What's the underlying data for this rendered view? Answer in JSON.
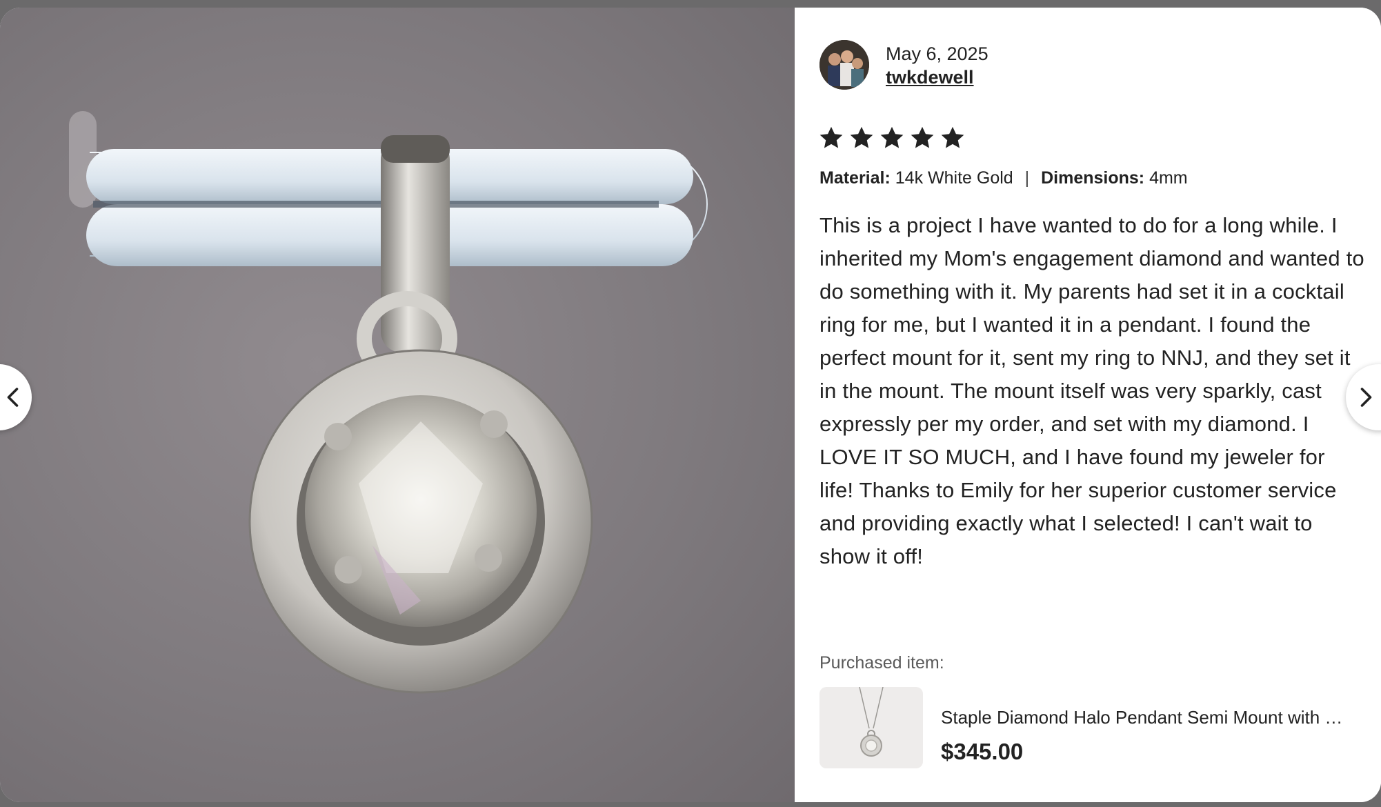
{
  "review": {
    "date": "May 6, 2025",
    "reviewer": "twkdewell",
    "rating": 5,
    "rating_max": 5,
    "variations": {
      "material_label": "Material:",
      "material_value": "14k White Gold",
      "separator": "|",
      "dimensions_label": "Dimensions:",
      "dimensions_value": "4mm"
    },
    "text": "This is a project I have wanted to do for a long while. I inherited my Mom's engagement diamond and wanted to do something with it. My parents had set it in a cocktail ring for me, but I wanted it in a pendant. I found the perfect mount for it, sent my ring to NNJ, and they set it in the mount. The mount itself was very sparkly, cast expressly per my order, and set with my diamond. I LOVE IT SO MUCH, and I have found my jeweler for life! Thanks to Emily for her superior customer service and providing exactly what I selected! I can't wait to show it off!"
  },
  "purchased": {
    "label": "Purchased item:",
    "title": "Staple Diamond Halo Pendant Semi Mount with Chain",
    "price": "$345.00"
  },
  "navigation": {
    "prev_icon": "chevron-left-icon",
    "next_icon": "chevron-right-icon"
  },
  "colors": {
    "text": "#222222",
    "muted": "#595959",
    "star": "#222222",
    "backdrop": "#6b6a6b"
  }
}
